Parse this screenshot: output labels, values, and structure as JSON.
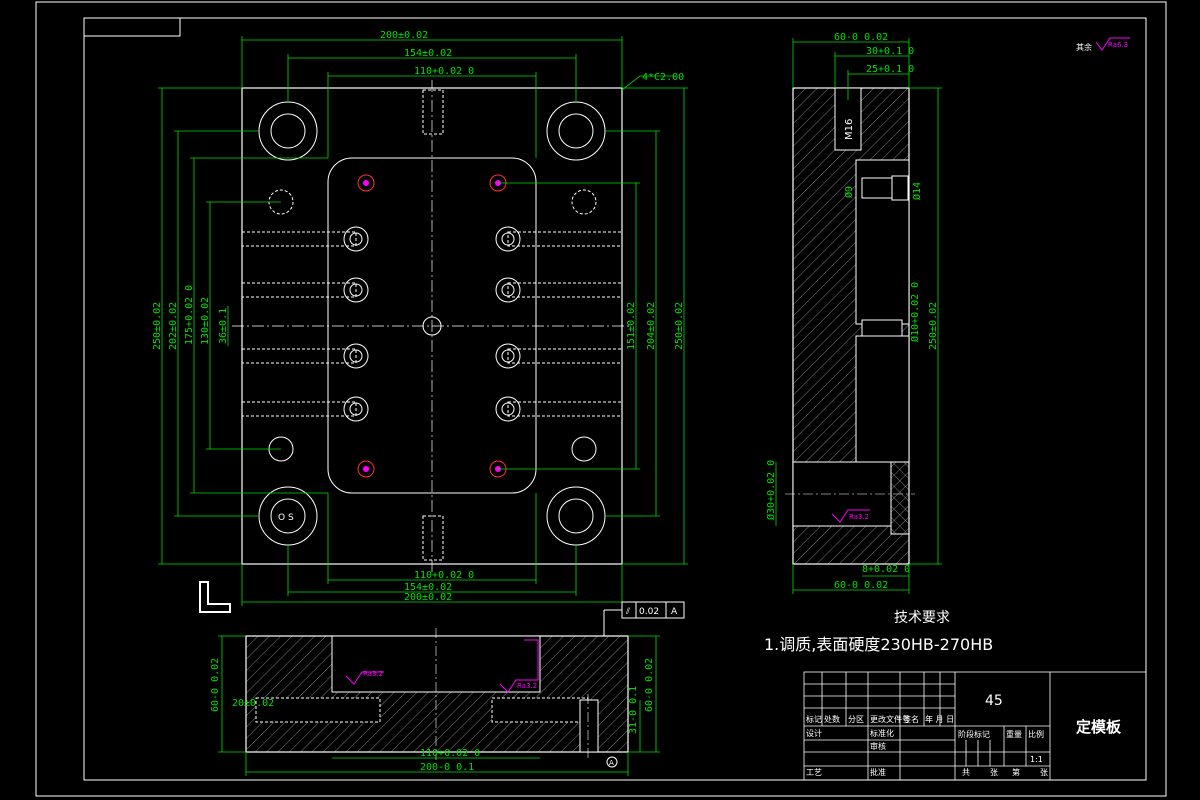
{
  "drawing": {
    "title": "定模板",
    "material": "45",
    "chamfer_note": "4*C2.00",
    "roughness_general": "Ra6.3",
    "roughness_general_prefix": "其余",
    "roughness_local": "Ra3.2",
    "geometric_tolerance": {
      "symbol": "⫽",
      "value": "0.02",
      "datum": "A"
    },
    "datum_label": "A"
  },
  "technical_requirements": {
    "heading": "技术要求",
    "items": [
      "1.调质,表面硬度230HB-270HB"
    ]
  },
  "top_view": {
    "dims_top": [
      "200±0.02",
      "154±0.02",
      "110+0.02 0"
    ],
    "dims_bottom": [
      "110+0.02 0",
      "154±0.02",
      "200±0.02"
    ],
    "dims_left": [
      "250±0.02",
      "202±0.02",
      "175+0.02 0",
      "130±0.02",
      "36±0.1"
    ],
    "dims_right": [
      "151±0.02",
      "204±0.02",
      "250±0.02"
    ],
    "center_marks": "O S"
  },
  "side_view": {
    "dims_top": [
      "60-0 0.02",
      "30+0.1 0",
      "25+0.1 0"
    ],
    "thread_label": "M16",
    "hole_labels": [
      "Ø9",
      "Ø14",
      "Ø10+0.02 0",
      "Ø30+0.02 0"
    ],
    "dim_height": "250±0.02",
    "dim_bottom": "60-0 0.02",
    "dim_step": "8+0.02 0"
  },
  "front_view": {
    "dims": [
      "60-0 0.02",
      "60-0 0.02",
      "20±0.02",
      "31-0 0.1",
      "110+0.02 0",
      "200-0 0.1"
    ]
  },
  "title_block": {
    "row_labels": [
      "标记",
      "处数",
      "分区",
      "更改文件号",
      "签名",
      "年 月 日"
    ],
    "left_labels": [
      "设计",
      "标准化",
      "审核",
      "工艺",
      "批准"
    ],
    "mid_labels": [
      "阶段标记",
      "重量",
      "比例"
    ],
    "scale": "1:1",
    "sheet": [
      "共",
      "张",
      "第",
      "张"
    ]
  }
}
